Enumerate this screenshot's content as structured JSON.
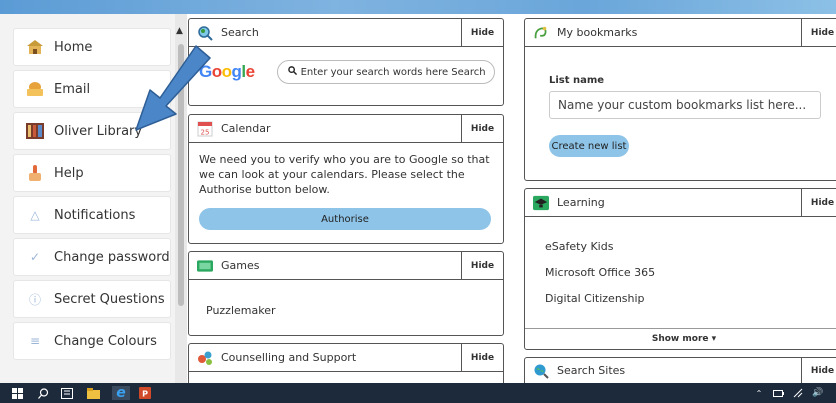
{
  "sidebar": {
    "items": [
      {
        "label": "Home",
        "icon": "home-icon"
      },
      {
        "label": "Email",
        "icon": "email-icon"
      },
      {
        "label": "Oliver Library",
        "icon": "library-icon"
      },
      {
        "label": "Help",
        "icon": "help-icon"
      },
      {
        "label": "Notifications",
        "icon": "bell-icon"
      },
      {
        "label": "Change password",
        "icon": "key-icon"
      },
      {
        "label": "Secret Questions",
        "icon": "question-icon"
      },
      {
        "label": "Change Colours",
        "icon": "list-icon"
      }
    ]
  },
  "search_panel": {
    "title": "Search",
    "hide": "Hide",
    "logo": "Google",
    "placeholder": "Enter your search words here",
    "button": "Search"
  },
  "calendar_panel": {
    "title": "Calendar",
    "hide": "Hide",
    "date": "25",
    "message": "We need you to verify who you are to Google so that we can look at your calendars. Please select the Authorise button below.",
    "button": "Authorise"
  },
  "games_panel": {
    "title": "Games",
    "hide": "Hide",
    "items": [
      "Puzzlemaker"
    ]
  },
  "counselling_panel": {
    "title": "Counselling and Support",
    "hide": "Hide"
  },
  "bookmarks_panel": {
    "title": "My bookmarks",
    "hide": "Hide",
    "list_name_label": "List name",
    "list_name_placeholder": "Name your custom bookmarks list here...",
    "create_button": "Create new list"
  },
  "learning_panel": {
    "title": "Learning",
    "hide": "Hide",
    "items": [
      "eSafety Kids",
      "Microsoft Office 365",
      "Digital Citizenship"
    ],
    "show_more": "Show more ▾"
  },
  "search_sites_panel": {
    "title": "Search Sites",
    "hide": "Hide"
  },
  "colors": {
    "accent": "#8ec4e8",
    "taskbar": "#1d2a3b",
    "arrow": "#4a86c8"
  }
}
